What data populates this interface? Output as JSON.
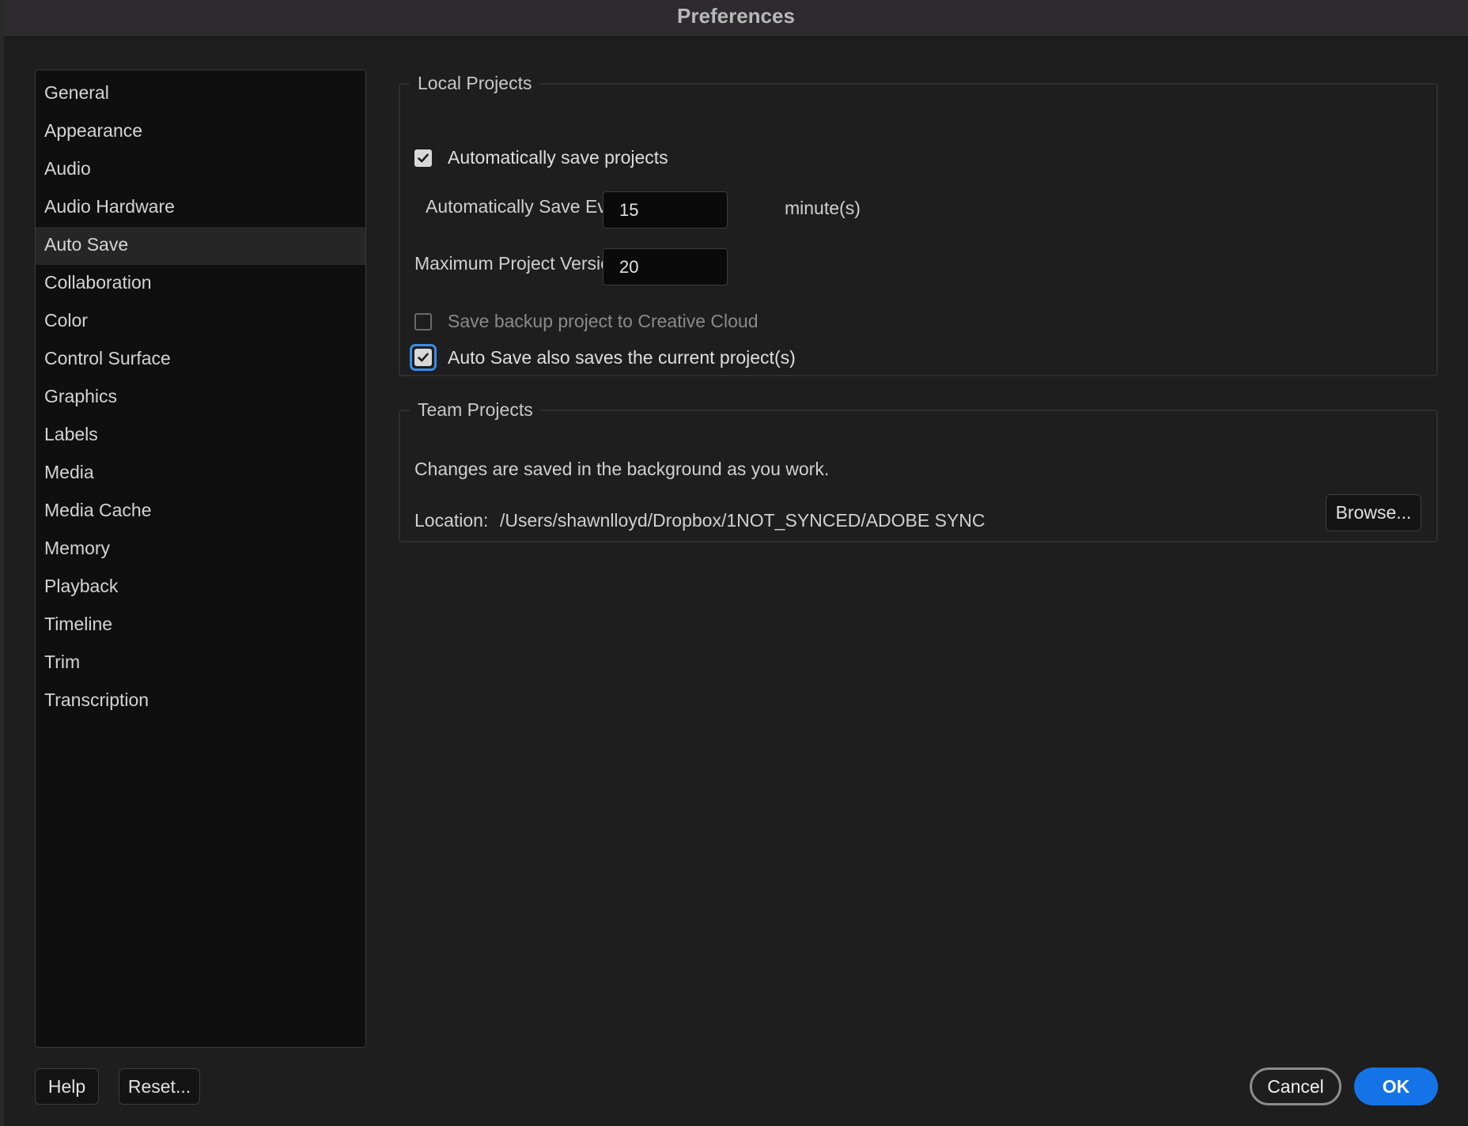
{
  "window": {
    "title": "Preferences"
  },
  "sidebar": {
    "items": [
      {
        "label": "General"
      },
      {
        "label": "Appearance"
      },
      {
        "label": "Audio"
      },
      {
        "label": "Audio Hardware"
      },
      {
        "label": "Auto Save"
      },
      {
        "label": "Collaboration"
      },
      {
        "label": "Color"
      },
      {
        "label": "Control Surface"
      },
      {
        "label": "Graphics"
      },
      {
        "label": "Labels"
      },
      {
        "label": "Media"
      },
      {
        "label": "Media Cache"
      },
      {
        "label": "Memory"
      },
      {
        "label": "Playback"
      },
      {
        "label": "Timeline"
      },
      {
        "label": "Trim"
      },
      {
        "label": "Transcription"
      }
    ],
    "selected": "Auto Save"
  },
  "local_projects": {
    "title": "Local Projects",
    "auto_save_checkbox": {
      "label": "Automatically save projects",
      "checked": true
    },
    "save_every": {
      "label": "Automatically Save Every:",
      "value": "15",
      "unit": "minute(s)"
    },
    "max_versions": {
      "label": "Maximum Project Versions:",
      "value": "20"
    },
    "backup_checkbox": {
      "label": "Save backup project to Creative Cloud",
      "checked": false,
      "enabled": false
    },
    "current_project_checkbox": {
      "label": "Auto Save also saves the current project(s)",
      "checked": true
    }
  },
  "team_projects": {
    "title": "Team Projects",
    "description": "Changes are saved in the background as you work.",
    "location_label": "Location:",
    "location_path": "/Users/shawnlloyd/Dropbox/1NOT_SYNCED/ADOBE SYNC",
    "browse_label": "Browse..."
  },
  "footer": {
    "help_label": "Help",
    "reset_label": "Reset...",
    "cancel_label": "Cancel",
    "ok_label": "OK"
  },
  "colors": {
    "accent": "#1473e6",
    "focus_ring": "#3b8be6",
    "background": "#1e1e1e",
    "sidebar_bg": "#0f0f0f"
  }
}
